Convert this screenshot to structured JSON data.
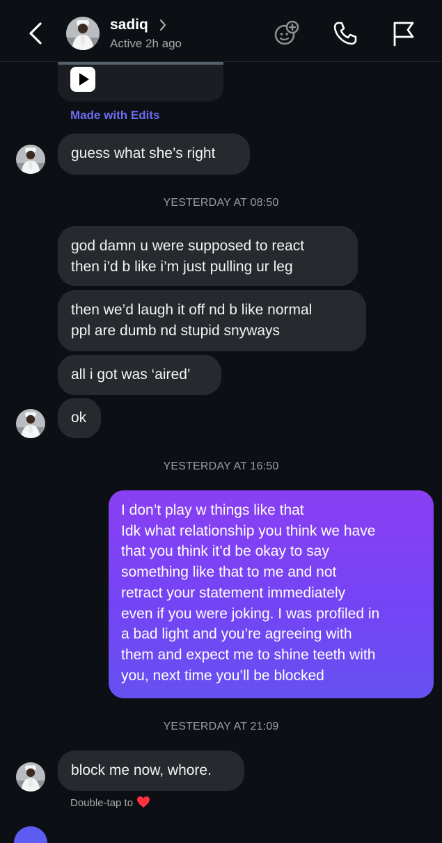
{
  "header": {
    "name": "sadiq",
    "status": "Active 2h ago"
  },
  "media": {
    "caption": "Made with Edits"
  },
  "messages": [
    {
      "text": "guess what she’s right"
    },
    {
      "text": "god damn u were supposed to react\nthen i’d b like i’m just pulling ur leg"
    },
    {
      "text": "then we’d laugh it off nd b like normal\nppl are dumb nd stupid snyways"
    },
    {
      "text": "all i got was ‘aired’"
    },
    {
      "text": "ok"
    },
    {
      "text": "I don’t play w things like that\nIdk what relationship you think we have\nthat you think it’d be okay to say\nsomething like that to me and not\nretract your statement immediately\neven if you were joking. I was profiled in\na bad light and you’re agreeing with\nthem and expect me to shine teeth with\nyou, next time you’ll be blocked"
    },
    {
      "text": "block me now, whore."
    }
  ],
  "timestamps": [
    "YESTERDAY AT 08:50",
    "YESTERDAY AT 16:50",
    "YESTERDAY AT 21:09"
  ],
  "hint": {
    "double_tap": "Double-tap to"
  },
  "icons": {
    "back": "chevron-left-icon",
    "profile_chevron": "chevron-right-icon",
    "effects": "effects-icon",
    "call": "phone-icon",
    "report": "flag-icon",
    "play": "play-icon",
    "heart": "heart-icon"
  },
  "colors": {
    "background": "#0c1014",
    "received_bubble": "#262a2e",
    "sent_gradient_top": "#8a3ff3",
    "sent_gradient_bottom": "#6651f1",
    "link": "#6d6cf2",
    "heart": "#ff3040"
  }
}
